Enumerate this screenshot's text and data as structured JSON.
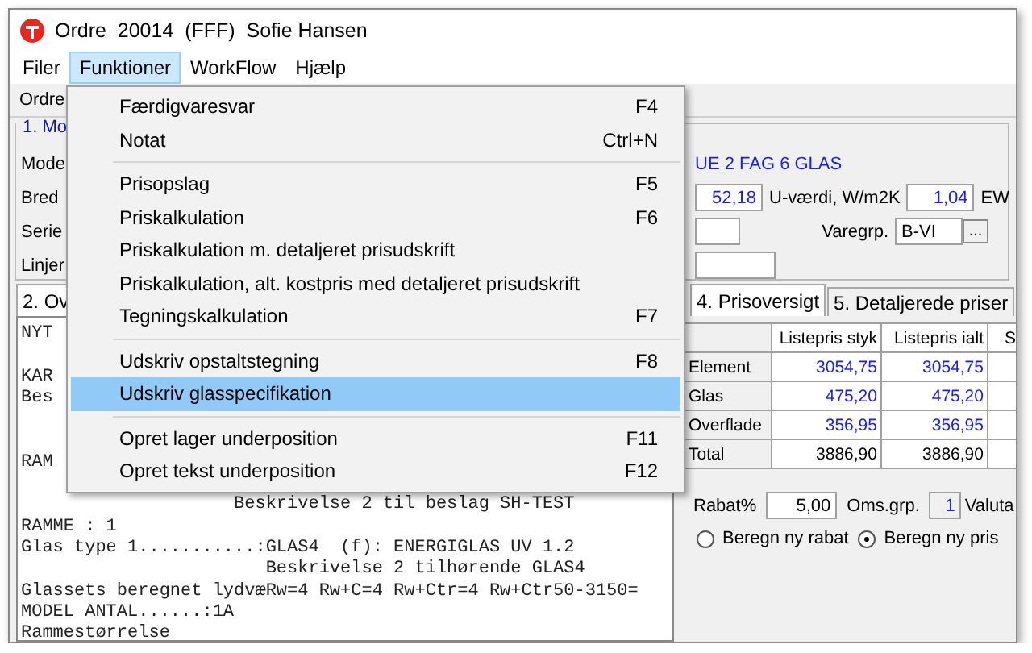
{
  "window": {
    "title": "Ordre  20014  (FFF)  Sofie Hansen"
  },
  "menu_bar": [
    {
      "label": "Filer",
      "selected": false
    },
    {
      "label": "Funktioner",
      "selected": true
    },
    {
      "label": "WorkFlow",
      "selected": false
    },
    {
      "label": "Hjælp",
      "selected": false
    }
  ],
  "menu": {
    "items": [
      {
        "kind": "item",
        "label": "Færdigvaresvar",
        "shortcut": "F4",
        "selected": false
      },
      {
        "kind": "item",
        "label": "Notat",
        "shortcut": "Ctrl+N",
        "selected": false
      },
      {
        "kind": "separator"
      },
      {
        "kind": "item",
        "label": "Prisopslag",
        "shortcut": "F5",
        "selected": false
      },
      {
        "kind": "item",
        "label": "Priskalkulation",
        "shortcut": "F6",
        "selected": false
      },
      {
        "kind": "item",
        "label": "Priskalkulation m. detaljeret prisudskrift",
        "selected": false
      },
      {
        "kind": "item",
        "label": "Priskalkulation, alt. kostpris med detaljeret prisudskrift",
        "selected": false
      },
      {
        "kind": "item",
        "label": "Tegningskalkulation",
        "shortcut": "F7",
        "selected": false
      },
      {
        "kind": "separator"
      },
      {
        "kind": "item",
        "label": "Udskriv opstaltstegning",
        "shortcut": "F8",
        "selected": false
      },
      {
        "kind": "item",
        "label": "Udskriv glasspecifikation",
        "selected": true
      },
      {
        "kind": "separator"
      },
      {
        "kind": "item",
        "label": "Opret lager underposition",
        "shortcut": "F11",
        "selected": false
      },
      {
        "kind": "item",
        "label": "Opret tekst underposition",
        "shortcut": "F12",
        "selected": false
      }
    ]
  },
  "toolbar": {
    "label": "Ordre"
  },
  "group": {
    "title": "1. Mo",
    "labels": [
      "Mode",
      "Bred",
      "Serie",
      "Linjer"
    ],
    "model_name": "UE 2 FAG 6 GLAS",
    "width_value": "52,18",
    "u_value_label": "U-værdi, W/m2K",
    "u_value": "1,04",
    "ew_label": "EW",
    "varegrp_label": "Varegrp.",
    "varegrp_value": "B-VI",
    "varegrp_button": "..."
  },
  "left_tab": {
    "label": "2. Ov",
    "selected": true
  },
  "description_lines": [
    {
      "kind": "text",
      "text": "NYT"
    },
    {
      "kind": "blank"
    },
    {
      "kind": "text",
      "text": "KAR"
    },
    {
      "kind": "text",
      "text": "Bes"
    },
    {
      "kind": "blank"
    },
    {
      "kind": "blank"
    },
    {
      "kind": "text",
      "text": "RAM"
    },
    {
      "kind": "blank"
    },
    {
      "kind": "text",
      "text": "                    Beskrivelse 2 til beslag SH-TEST"
    },
    {
      "kind": "text",
      "text": "RAMME : 1"
    },
    {
      "kind": "text",
      "text": "Glas type 1...........:GLAS4  (f): ENERGIGLAS UV 1.2"
    },
    {
      "kind": "text",
      "text": "                       Beskrivelse 2 tilhørende GLAS4"
    },
    {
      "kind": "text",
      "text": "Glassets beregnet lydvæRw=4 Rw+C=4 Rw+Ctr=4 Rw+Ctr50-3150="
    },
    {
      "kind": "text",
      "text": "MODEL ANTAL......:1A"
    },
    {
      "kind": "text",
      "text": "Rammestørrelse"
    }
  ],
  "price_tabs": [
    {
      "label": "4. Prisoversigt",
      "selected": true
    },
    {
      "label": "5. Detaljerede priser",
      "selected": false
    }
  ],
  "price_table": {
    "columns": [
      "Listepris styk",
      "Listepris ialt",
      "S"
    ],
    "rows": [
      {
        "kind": "entry",
        "label": "Element",
        "values": [
          "3054,75",
          "3054,75"
        ]
      },
      {
        "kind": "entry",
        "label": "Glas",
        "values": [
          "475,20",
          "475,20"
        ]
      },
      {
        "kind": "entry",
        "label": "Overflade",
        "values": [
          "356,95",
          "356,95"
        ]
      },
      {
        "kind": "total",
        "label": "Total",
        "values": [
          "3886,90",
          "3886,90"
        ]
      }
    ]
  },
  "discount": {
    "label": "Rabat%",
    "value": "5,00",
    "group_label": "Oms.grp.",
    "group_value": "1",
    "currency_label": "Valuta"
  },
  "radios": [
    {
      "label": "Beregn ny rabat",
      "selected": false
    },
    {
      "label": "Beregn ny pris",
      "selected": true
    }
  ]
}
